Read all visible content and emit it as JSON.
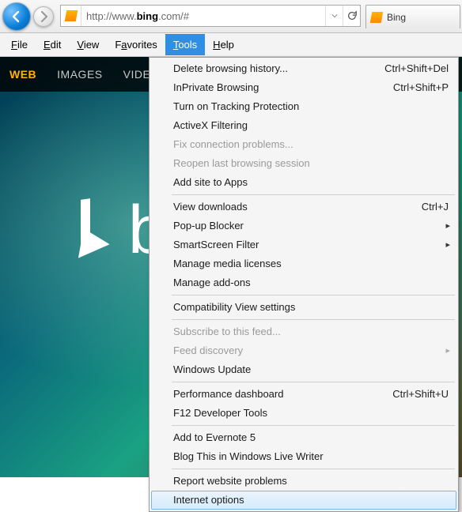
{
  "addressbar": {
    "url_prefix": "http://www.",
    "url_bold": "bing",
    "url_suffix": ".com/#"
  },
  "tab": {
    "title": "Bing"
  },
  "menubar": {
    "file": "File",
    "edit": "Edit",
    "view": "View",
    "favorites_pre": "F",
    "favorites_u": "a",
    "favorites_post": "vorites",
    "tools": "Tools",
    "help": "Help"
  },
  "page_tabs": {
    "web": "WEB",
    "images": "IMAGES",
    "videos": "VIDE"
  },
  "logo_text": "b",
  "tools_menu": [
    {
      "label": "Delete browsing history...",
      "shortcut": "Ctrl+Shift+Del"
    },
    {
      "label": "InPrivate Browsing",
      "shortcut": "Ctrl+Shift+P"
    },
    {
      "label": "Turn on Tracking Protection"
    },
    {
      "label": "ActiveX Filtering"
    },
    {
      "label": "Fix connection problems...",
      "disabled": true
    },
    {
      "label": "Reopen last browsing session",
      "disabled": true
    },
    {
      "label": "Add site to Apps"
    },
    {
      "sep": true
    },
    {
      "label": "View downloads",
      "shortcut": "Ctrl+J"
    },
    {
      "label": "Pop-up Blocker",
      "submenu": true
    },
    {
      "label": "SmartScreen Filter",
      "submenu": true
    },
    {
      "label": "Manage media licenses"
    },
    {
      "label": "Manage add-ons"
    },
    {
      "sep": true
    },
    {
      "label": "Compatibility View settings"
    },
    {
      "sep": true
    },
    {
      "label": "Subscribe to this feed...",
      "disabled": true
    },
    {
      "label": "Feed discovery",
      "disabled": true,
      "submenu": true
    },
    {
      "label": "Windows Update"
    },
    {
      "sep": true
    },
    {
      "label": "Performance dashboard",
      "shortcut": "Ctrl+Shift+U"
    },
    {
      "label": "F12 Developer Tools"
    },
    {
      "sep": true
    },
    {
      "label": "Add to Evernote 5"
    },
    {
      "label": "Blog This in Windows Live Writer"
    },
    {
      "sep": true
    },
    {
      "label": "Report website problems"
    },
    {
      "label": "Internet options",
      "highlight": true
    }
  ]
}
